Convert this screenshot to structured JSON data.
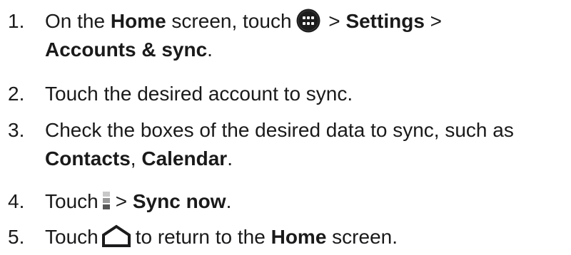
{
  "steps": [
    {
      "number": "1.",
      "line1": {
        "t1": "On the ",
        "b1": "Home",
        "t2": " screen, touch",
        "icon": "apps-grid-icon",
        "t3": " > ",
        "b2": "Settings",
        "t4": " >"
      },
      "line2": {
        "b1": "Accounts & sync",
        "t1": "."
      }
    },
    {
      "number": "2.",
      "text": "Touch the desired account to sync."
    },
    {
      "number": "3.",
      "line1": {
        "t1": "Check the boxes of the desired data to sync, such as"
      },
      "line2": {
        "b1": "Contacts",
        "t1": ", ",
        "b2": "Calendar",
        "t2": "."
      }
    },
    {
      "number": "4.",
      "t1": "Touch",
      "icon": "menu-icon",
      "t2": "> ",
      "b1": "Sync now",
      "t3": "."
    },
    {
      "number": "5.",
      "t1": "Touch",
      "icon": "home-icon",
      "t2": "to return to the ",
      "b1": "Home",
      "t3": " screen."
    }
  ],
  "colors": {
    "text": "#1a1a1a",
    "icon_dark": "#1c1c1c",
    "icon_light": "#ffffff",
    "menu_light": "#c8c8c8",
    "menu_dark": "#555555"
  }
}
